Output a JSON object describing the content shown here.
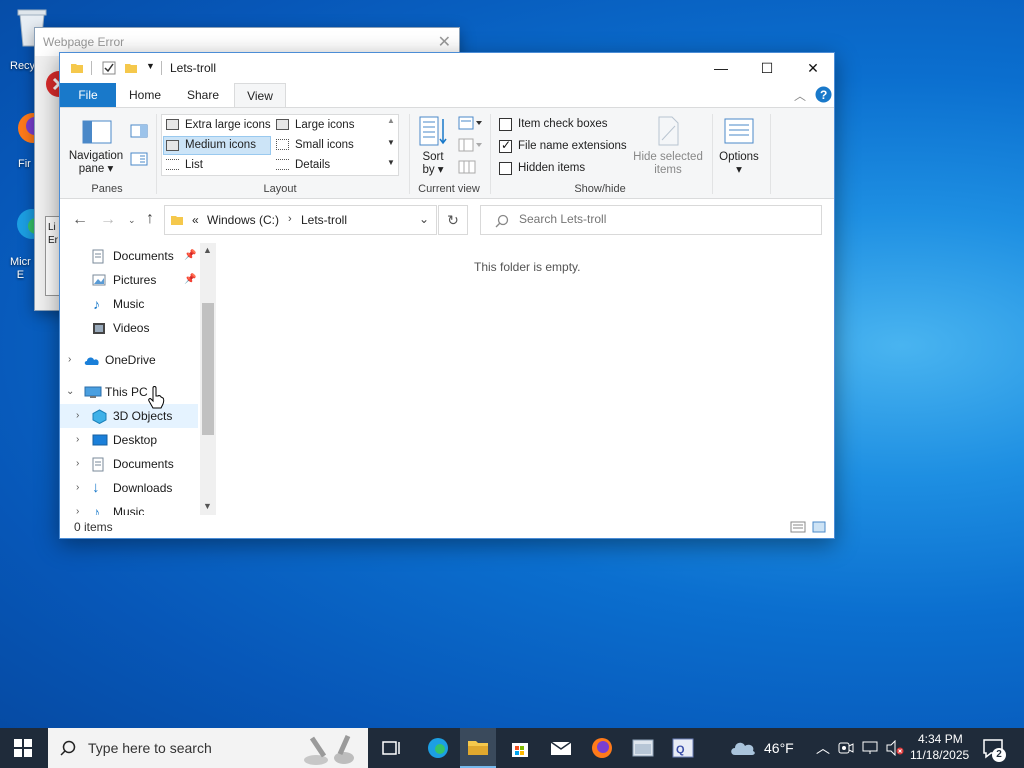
{
  "desktop": {
    "icons": [
      {
        "label": "Recy"
      },
      {
        "label": "Fir"
      },
      {
        "label": "Micr\nE"
      }
    ]
  },
  "bg_window": {
    "title": "Webpage Error",
    "snippet": "Li\nEr"
  },
  "explorer": {
    "title": "Lets-troll",
    "tabs": [
      "File",
      "Home",
      "Share",
      "View"
    ],
    "active_tab": "View",
    "ribbon": {
      "panes": {
        "navigation_pane": "Navigation pane",
        "group": "Panes"
      },
      "layout": {
        "items": [
          "Extra large icons",
          "Large icons",
          "Medium icons",
          "Small icons",
          "List",
          "Details"
        ],
        "selected": "Medium icons",
        "group": "Layout"
      },
      "current_view": {
        "sort_by": "Sort by",
        "group": "Current view"
      },
      "show_hide": {
        "item_check_boxes": "Item check boxes",
        "file_name_extensions": "File name extensions",
        "hidden_items": "Hidden items",
        "hide_selected": "Hide selected items",
        "group": "Show/hide",
        "checked": {
          "item_check_boxes": false,
          "file_name_extensions": true,
          "hidden_items": false
        }
      },
      "options": "Options"
    },
    "address": {
      "prefix": "«",
      "crumbs": [
        "Windows (C:)",
        "Lets-troll"
      ],
      "search_placeholder": "Search Lets-troll"
    },
    "nav": {
      "quick": [
        "Documents",
        "Pictures",
        "Music",
        "Videos"
      ],
      "onedrive": "OneDrive",
      "this_pc": "This PC",
      "pc_items": [
        "3D Objects",
        "Desktop",
        "Documents",
        "Downloads",
        "Music"
      ]
    },
    "empty_message": "This folder is empty.",
    "status": "0 items"
  },
  "taskbar": {
    "search_placeholder": "Type here to search",
    "weather": "46°F",
    "time": "4:34 PM",
    "date": "11/18/2025",
    "notifications": "2"
  },
  "colors": {
    "file_tab": "#1979ca",
    "accent": "#0078d7",
    "taskbar": "#1f2b3a"
  }
}
